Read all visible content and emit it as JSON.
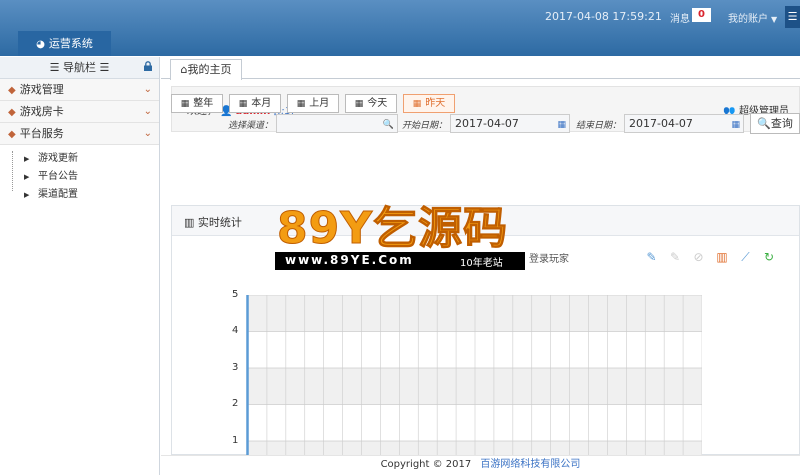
{
  "header": {
    "datetime": "2017-04-08 17:59:21",
    "messages_label": "消息",
    "messages_count": "0",
    "account_label": "我的账户",
    "system_tab": "运营系统"
  },
  "sidebar": {
    "title": "☰ 导航栏 ☰",
    "menus": [
      {
        "label": "游戏管理"
      },
      {
        "label": "游戏房卡"
      },
      {
        "label": "平台服务"
      }
    ],
    "submenu": [
      "游戏更新",
      "平台公告",
      "渠道配置"
    ]
  },
  "main": {
    "tab_home": "我的主页",
    "welcome_prefix": "欢迎，",
    "user": "admin",
    "ip": "[::1]",
    "role": "超级管理员",
    "date_buttons": [
      "整年",
      "本月",
      "上月",
      "今天",
      "昨天"
    ],
    "channel_label": "选择渠道：",
    "start_label": "开始日期：",
    "start_value": "2017-04-07",
    "end_label": "结束日期：",
    "end_value": "2017-04-07",
    "query_label": "查询",
    "stats_title": "实时统计",
    "legend_login": "登录玩家"
  },
  "chart_data": {
    "type": "line",
    "series": [
      {
        "name": "登录玩家",
        "values": []
      }
    ],
    "y_ticks": [
      "5",
      "4",
      "3",
      "2",
      "1"
    ],
    "ylim": [
      0,
      5
    ],
    "grid": true,
    "colors": {
      "axis": "#5b9bd5",
      "band": "#f0f0f0",
      "grid": "#cccccc"
    }
  },
  "footer": {
    "copyright": "Copyright © 2017",
    "company": "百游网络科技有限公司"
  },
  "watermark": {
    "brand": "89Y乞源码",
    "url": "www.89YE.Com",
    "slogan": "10年老站"
  },
  "colors": {
    "header_top": "#5a8fc2",
    "header_bottom": "#2d6aa3",
    "accent_red": "#d9242c",
    "accent_orange": "#e07030",
    "link_blue": "#3a72c4"
  }
}
